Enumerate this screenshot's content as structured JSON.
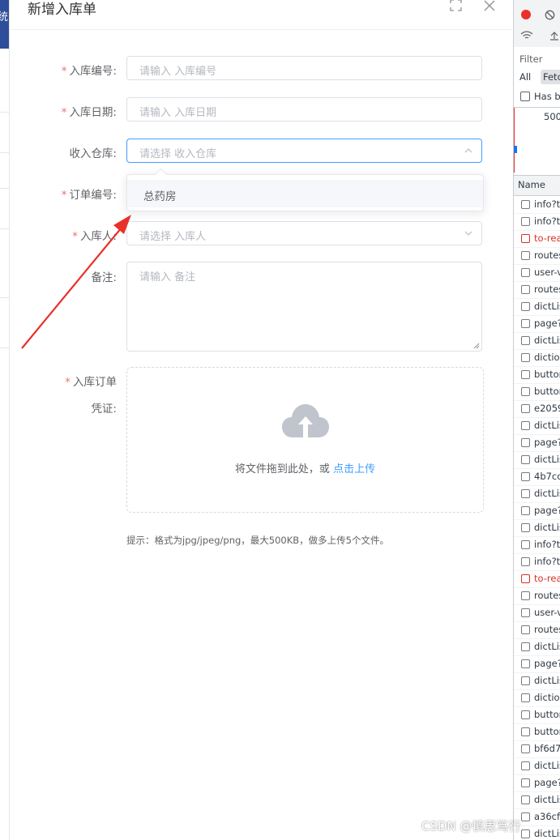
{
  "background_page": {
    "edge_text": "统"
  },
  "dialog": {
    "title": "新增入库单",
    "fullscreen_icon": "fullscreen-icon",
    "close_icon": "close-icon"
  },
  "form": {
    "fields": [
      {
        "label": "入库编号:",
        "required": true,
        "type": "input",
        "placeholder": "请输入 入库编号"
      },
      {
        "label": "入库日期:",
        "required": true,
        "type": "input",
        "placeholder": "请输入 入库日期"
      },
      {
        "label": "收入仓库:",
        "required": false,
        "type": "select",
        "placeholder": "请选择 收入仓库",
        "open": true
      },
      {
        "label": "订单编号:",
        "required": true,
        "type": "input"
      },
      {
        "label": "入库人:",
        "required": true,
        "type": "select",
        "placeholder": "请选择 入库人"
      },
      {
        "label": "备注:",
        "required": false,
        "type": "textarea",
        "placeholder": "请输入 备注"
      }
    ],
    "dropdown_options": [
      "总药房"
    ],
    "upload": {
      "label_line1": "入库订单",
      "label_line2": "凭证:",
      "required": true,
      "icon": "upload-cloud-icon",
      "text_prefix": "将文件拖到此处，或 ",
      "text_link": "点击上传"
    },
    "tip": "提示：格式为jpg/jpeg/png，最大500KB，做多上传5个文件。"
  },
  "devtools": {
    "filter_label": "Filter",
    "all_tab": "All",
    "fetch_tab": "Fetc",
    "has_blocked": "Has bl",
    "timeline_value": "500",
    "name_header": "Name",
    "requests": [
      {
        "name": "info?t=",
        "failed": false
      },
      {
        "name": "info?t=",
        "failed": false
      },
      {
        "name": "to-rea",
        "failed": true
      },
      {
        "name": "routes",
        "failed": false
      },
      {
        "name": "user-v",
        "failed": false
      },
      {
        "name": "routes",
        "failed": false
      },
      {
        "name": "dictLis",
        "failed": false
      },
      {
        "name": "page?",
        "failed": false
      },
      {
        "name": "dictLis",
        "failed": false
      },
      {
        "name": "diction",
        "failed": false
      },
      {
        "name": "button",
        "failed": false
      },
      {
        "name": "button",
        "failed": false
      },
      {
        "name": "e2059",
        "failed": false
      },
      {
        "name": "dictLis",
        "failed": false
      },
      {
        "name": "page?",
        "failed": false
      },
      {
        "name": "dictLis",
        "failed": false
      },
      {
        "name": "4b7cc",
        "failed": false
      },
      {
        "name": "dictLis",
        "failed": false
      },
      {
        "name": "page?",
        "failed": false
      },
      {
        "name": "dictLis",
        "failed": false
      },
      {
        "name": "info?t=",
        "failed": false
      },
      {
        "name": "info?t=",
        "failed": false
      },
      {
        "name": "to-rea",
        "failed": true
      },
      {
        "name": "routes",
        "failed": false
      },
      {
        "name": "user-v",
        "failed": false
      },
      {
        "name": "routes",
        "failed": false
      },
      {
        "name": "dictLis",
        "failed": false
      },
      {
        "name": "page?",
        "failed": false
      },
      {
        "name": "dictLis",
        "failed": false
      },
      {
        "name": "diction",
        "failed": false
      },
      {
        "name": "button",
        "failed": false
      },
      {
        "name": "button",
        "failed": false
      },
      {
        "name": "bf6d7",
        "failed": false
      },
      {
        "name": "dictLis",
        "failed": false
      },
      {
        "name": "page?",
        "failed": false
      },
      {
        "name": "dictLis",
        "failed": false
      },
      {
        "name": "a36cfb",
        "failed": false
      },
      {
        "name": "dictLis",
        "failed": false
      }
    ]
  },
  "watermark": "CSDN @慎思笃行",
  "colors": {
    "primary": "#409eff",
    "required": "#f56c6c",
    "annotation": "#e8312b",
    "error": "#d93025"
  }
}
